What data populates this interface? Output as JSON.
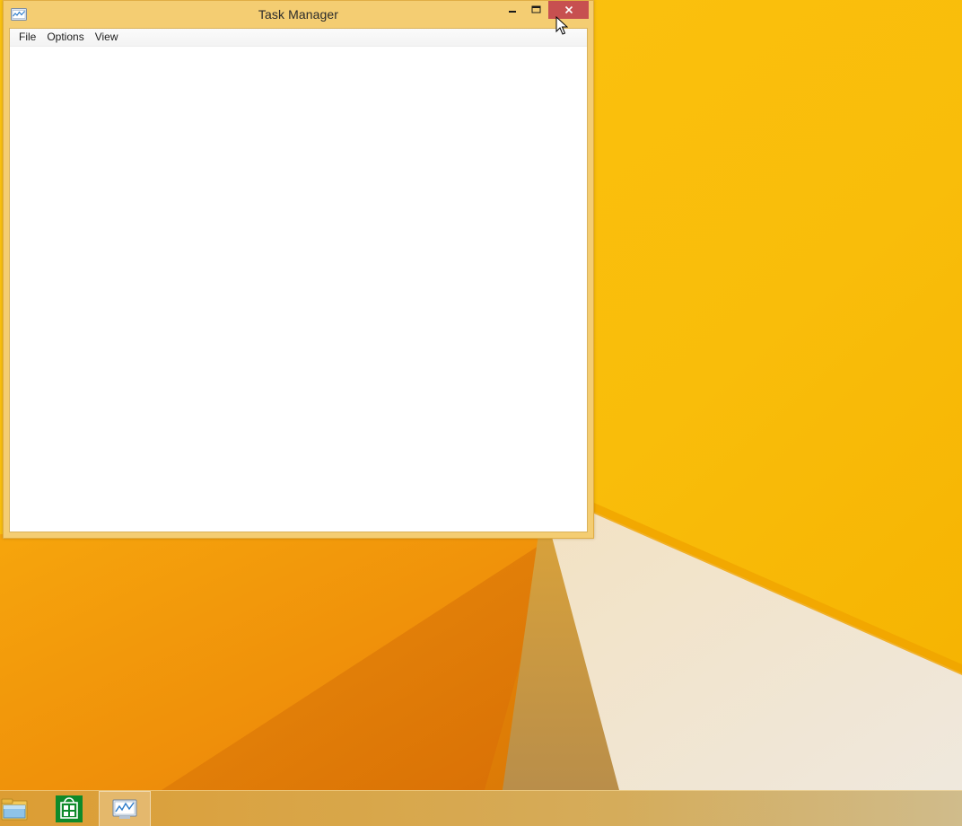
{
  "window": {
    "title": "Task Manager",
    "app_icon": "task-manager-icon",
    "controls": {
      "minimize_icon": "minimize-icon",
      "maximize_icon": "maximize-icon",
      "close_icon": "close-icon"
    },
    "menu": [
      "File",
      "Options",
      "View"
    ]
  },
  "taskbar": {
    "items": [
      {
        "icon": "file-explorer-icon"
      },
      {
        "icon": "store-icon"
      },
      {
        "icon": "task-manager-icon",
        "active": true
      }
    ]
  },
  "colors": {
    "wallpaper_base": "#f7b500",
    "window_frame": "#f4cd72",
    "close_button": "#c75050",
    "store_tile": "#0f8a2a"
  }
}
